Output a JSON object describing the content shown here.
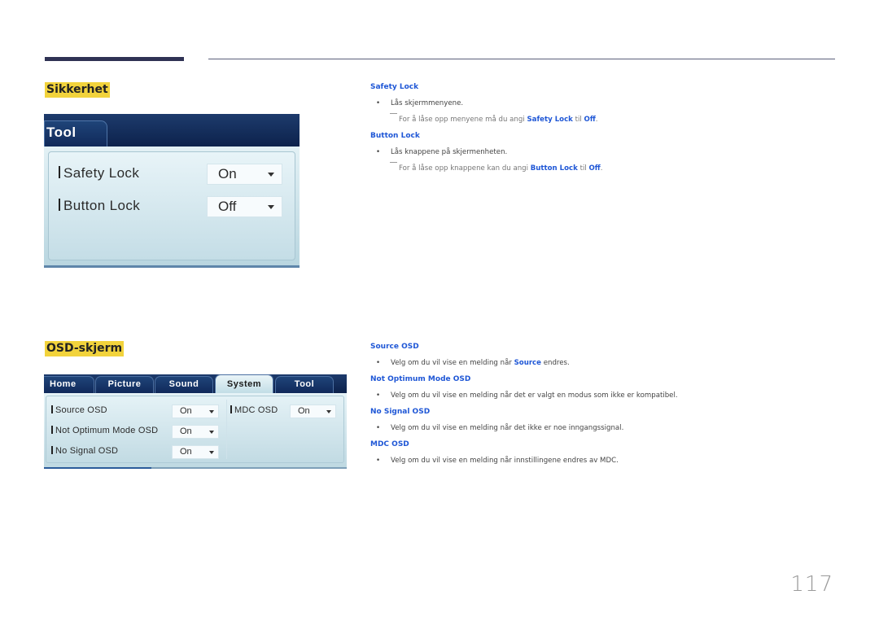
{
  "page": {
    "page_number": "117"
  },
  "sections": {
    "security": {
      "title": "Sikkerhet",
      "panel": {
        "tab_label": "Tool",
        "rows": [
          {
            "label": "Safety Lock",
            "value": "On"
          },
          {
            "label": "Button Lock",
            "value": "Off"
          }
        ]
      },
      "descriptions": [
        {
          "heading": "Safety Lock",
          "bullet": "Lås skjermmenyene.",
          "note": {
            "pre": "For å låse opp menyene må du angi ",
            "hl1": "Safety Lock",
            "mid": " til ",
            "hl2": "Off",
            "post": "."
          }
        },
        {
          "heading": "Button Lock",
          "bullet": "Lås knappene på skjermenheten.",
          "note": {
            "pre": "For å låse opp knappene kan du angi ",
            "hl1": "Button Lock",
            "mid": " til ",
            "hl2": "Off",
            "post": "."
          }
        }
      ]
    },
    "osd": {
      "title": "OSD-skjerm",
      "panel": {
        "tabs": [
          "Home",
          "Picture",
          "Sound",
          "System",
          "Tool"
        ],
        "active_tab": "System",
        "rows": [
          {
            "label": "Source OSD",
            "value": "On"
          },
          {
            "label": "Not Optimum Mode OSD",
            "value": "On"
          },
          {
            "label": "No Signal OSD",
            "value": "On"
          },
          {
            "label": "MDC OSD",
            "value": "On"
          }
        ]
      },
      "descriptions": [
        {
          "heading": "Source OSD",
          "bullet_pre": "Velg om du vil vise en melding når ",
          "bullet_hl": "Source",
          "bullet_post": " endres."
        },
        {
          "heading": "Not Optimum Mode OSD",
          "bullet": "Velg om du vil vise en melding når det er valgt en modus som ikke er kompatibel."
        },
        {
          "heading": "No Signal OSD",
          "bullet": "Velg om du vil vise en melding når det ikke er noe inngangssignal."
        },
        {
          "heading": "MDC OSD",
          "bullet": "Velg om du vil vise en melding når innstillingene endres av MDC."
        }
      ]
    }
  },
  "icons": {
    "bullet": "•",
    "dropdown": "chevron-down-icon"
  },
  "colors": {
    "heading_highlight": "#f2d33c",
    "link_blue": "#1f57d6",
    "panel_navy": "#0d224c",
    "header_bar": "#2f3254"
  }
}
